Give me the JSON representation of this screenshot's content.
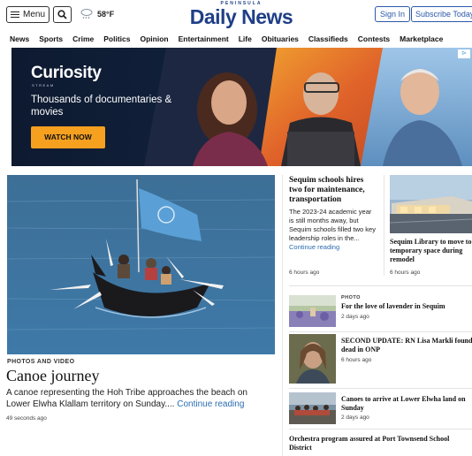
{
  "header": {
    "menu_label": "Menu",
    "temperature": "58°F",
    "logo_kicker": "PENINSULA",
    "logo_name": "Daily News",
    "signin_label": "Sign In",
    "subscribe_label": "Subscribe Today"
  },
  "nav": {
    "items": [
      "News",
      "Sports",
      "Crime",
      "Politics",
      "Opinion",
      "Entertainment",
      "Life",
      "Obituaries",
      "Classifieds",
      "Contests",
      "Marketplace"
    ]
  },
  "ad": {
    "brand": "Curiosity",
    "brand_sub": "STREAM",
    "tagline": "Thousands of documentaries & movies",
    "cta": "WATCH NOW",
    "accent": "#f6a020"
  },
  "main_story": {
    "kicker": "PHOTOS AND VIDEO",
    "title": "Canoe journey",
    "summary": "A canoe representing the Hoh Tribe approaches the beach on Lower Elwha Klallam territory on Sunday.... ",
    "more": "Continue reading",
    "time": "49 seconds ago"
  },
  "story_1": {
    "title": "Sequim schools hires two for maintenance, transportation",
    "summary": "The 2023-24 academic year is still months away, but Sequim schools filled two key leadership roles in the... ",
    "more": "Continue reading",
    "time": "6 hours ago"
  },
  "story_2": {
    "title": "Sequim Library to move to temporary space during remodel",
    "time": "6 hours ago"
  },
  "list": [
    {
      "kicker": "PHOTO",
      "title": "For the love of lavender in Sequim",
      "time": "2 days ago"
    },
    {
      "kicker": "",
      "title": "SECOND UPDATE: RN Lisa Markli found dead in ONP",
      "time": "6 hours ago"
    },
    {
      "kicker": "",
      "title": "Canoes to arrive at Lower Elwha land on Sunday",
      "time": "2 days ago"
    }
  ],
  "last_story": {
    "title": "Orchestra program assured at Port Townsend School District"
  },
  "colors": {
    "brand_blue": "#1f3f86",
    "link_blue": "#2b6cb0"
  }
}
